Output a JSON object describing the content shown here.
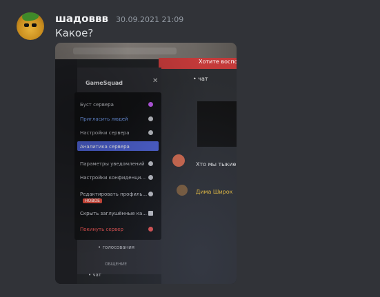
{
  "message": {
    "author": "шадоввв",
    "timestamp": "30.09.2021 21:09",
    "text": "Какое?",
    "avatar_icon": "pineapple-avatar-icon"
  },
  "attachment": {
    "type": "photo",
    "photo_text": {
      "banner": "Хотите восполь",
      "server_name": "GameSquad",
      "channel_header": "• чат",
      "menu_items": [
        "Буст сервера",
        "Пригласить людей",
        "Настройки сервера",
        "Аналитика сервера",
        "Параметры уведомлений",
        "Настройки конфиденци...",
        "Редактировать профиль...",
        "Скрыть заглушённые ка...",
        "Покинуть сервер"
      ],
      "menu_badge": "НОВОЕ",
      "selected_menu_item": "Аналитика сервера",
      "chat_lines": [
        "Хто мы тыкие",
        "Дима Широк"
      ],
      "voice_channel": "• голосования",
      "category": "ОБЩЕНИЕ",
      "text_channel": "• чат"
    }
  },
  "colors": {
    "background": "#313338",
    "username": "#f2f3f5",
    "timestamp": "#949ba4",
    "highlight": "#4f64d9",
    "danger": "#e2514f",
    "accent_gold": "#f0c23b"
  }
}
